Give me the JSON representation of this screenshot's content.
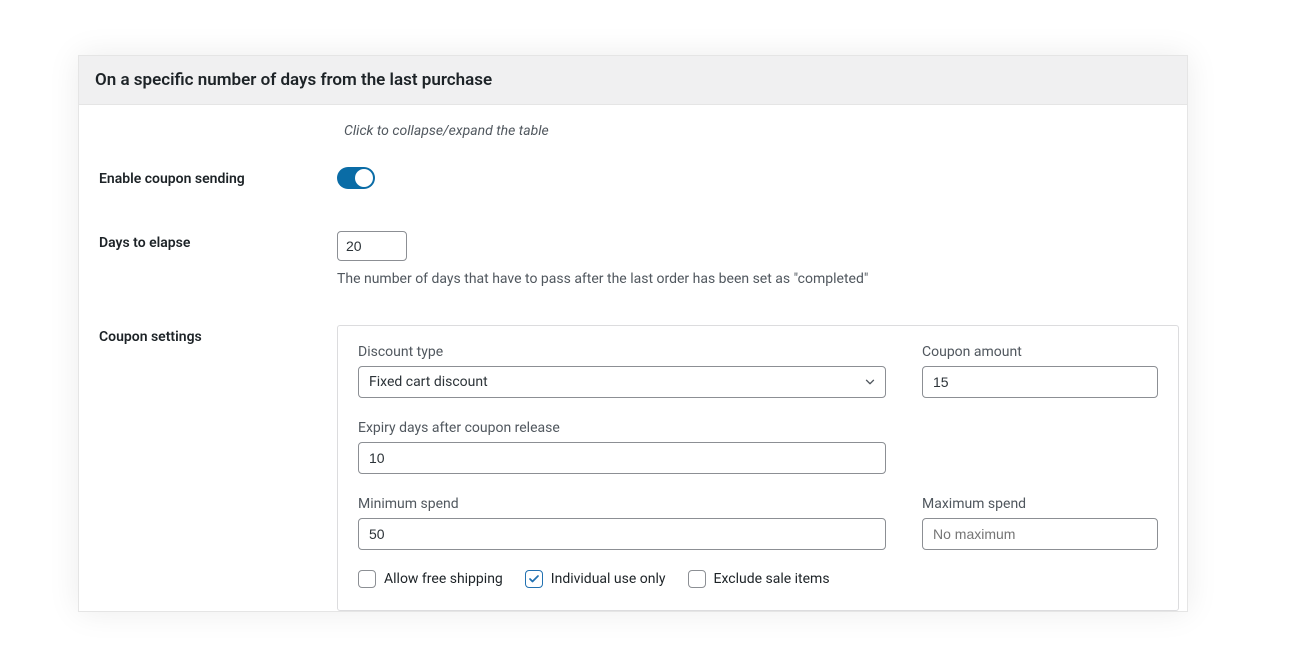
{
  "panel": {
    "title": "On a specific number of days from the last purchase",
    "collapseHint": "Click to collapse/expand the table"
  },
  "enableSending": {
    "label": "Enable coupon sending",
    "value": true
  },
  "daysToElapse": {
    "label": "Days to elapse",
    "value": "20",
    "helper": "The number of days that have to pass after the last order has been set as \"completed\""
  },
  "couponSettings": {
    "label": "Coupon settings",
    "discountType": {
      "label": "Discount type",
      "value": "Fixed cart discount"
    },
    "couponAmount": {
      "label": "Coupon amount",
      "value": "15"
    },
    "expiryDays": {
      "label": "Expiry days after coupon release",
      "value": "10"
    },
    "minSpend": {
      "label": "Minimum spend",
      "value": "50"
    },
    "maxSpend": {
      "label": "Maximum spend",
      "placeholder": "No maximum",
      "value": ""
    },
    "checkboxes": {
      "allowFreeShipping": {
        "label": "Allow free shipping",
        "checked": false
      },
      "individualUseOnly": {
        "label": "Individual use only",
        "checked": true
      },
      "excludeSaleItems": {
        "label": "Exclude sale items",
        "checked": false
      }
    }
  }
}
